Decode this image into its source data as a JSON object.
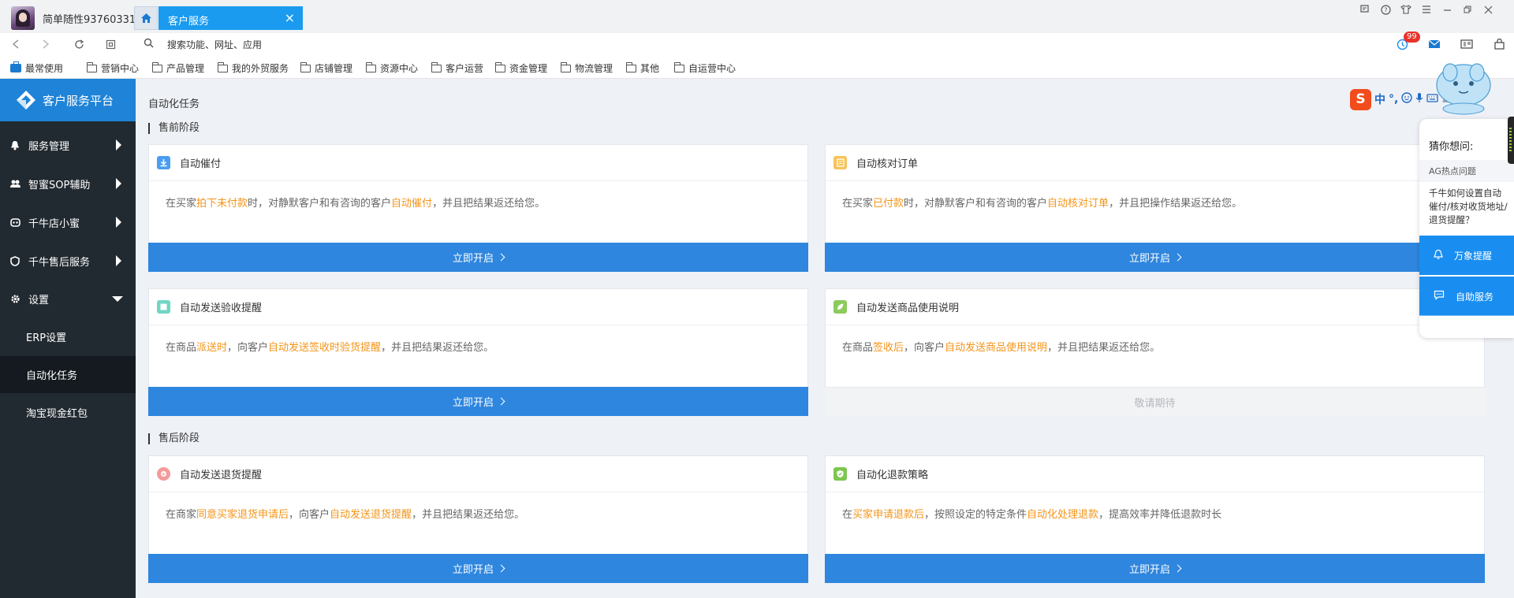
{
  "window": {
    "username": "简单随性93760331",
    "tab_label": "客户服务"
  },
  "address": {
    "search_text": "搜索功能、网址、应用",
    "mail_badge": "99"
  },
  "bookmarks": [
    "最常使用",
    "营销中心",
    "产品管理",
    "我的外贸服务",
    "店铺管理",
    "资源中心",
    "客户运营",
    "资金管理",
    "物流管理",
    "其他",
    "自运营中心"
  ],
  "sidebar": {
    "brand": "客户服务平台",
    "items": [
      {
        "label": "服务管理"
      },
      {
        "label": "智蜜SOP辅助"
      },
      {
        "label": "千牛店小蜜"
      },
      {
        "label": "千牛售后服务"
      },
      {
        "label": "设置"
      }
    ],
    "sub_items": [
      {
        "label": "ERP设置"
      },
      {
        "label": "自动化任务"
      },
      {
        "label": "淘宝现金红包"
      }
    ]
  },
  "main": {
    "page_title": "自动化任务",
    "section_pre": "售前阶段",
    "section_post": "售后阶段",
    "cards": [
      {
        "title": "自动催付",
        "desc": [
          "在买家",
          "拍下未付款",
          "时，对静默客户和有咨询的客户",
          "自动催付",
          "，并且把结果返还给您。"
        ],
        "button": "立即开启"
      },
      {
        "title": "自动核对订单",
        "desc": [
          "在买家",
          "已付款",
          "时，对静默客户和有咨询的客户",
          "自动核对订单",
          "，并且把操作结果返还给您。"
        ],
        "button": "立即开启"
      },
      {
        "title": "自动发送验收提醒",
        "desc": [
          "在商品",
          "派送时",
          "，向客户",
          "自动发送签收时验货提醒",
          "，并且把结果返还给您。"
        ],
        "button": "立即开启"
      },
      {
        "title": "自动发送商品使用说明",
        "desc": [
          "在商品",
          "签收后",
          "，向客户",
          "自动发送商品使用说明",
          "，并且把结果返还给您。"
        ],
        "button": "敬请期待"
      },
      {
        "title": "自动发送退货提醒",
        "desc": [
          "在商家",
          "同意买家退货申请后",
          "，向客户",
          "自动发送退货提醒",
          "，并且把结果返还给您。"
        ],
        "button": "立即开启"
      },
      {
        "title": "自动化退款策略",
        "desc": [
          "在",
          "买家申请退款后",
          "，按照设定的特定条件",
          "自动化处理退款",
          "，提高效率并降低退款时长"
        ],
        "button": "立即开启"
      }
    ]
  },
  "ime": {
    "logo": "S",
    "lang": "中",
    "punct": "°,"
  },
  "assistant": {
    "title": "猜你想问:",
    "hot_label": "AG热点问题",
    "question": "千牛如何设置自动催付/核对收货地址/退货提醒？",
    "btn_reminder": "万象提醒",
    "btn_self_service": "自助服务"
  },
  "colors": {
    "accent": "#2e86de",
    "highlight": "#f39419",
    "sidebar_bg": "#222a31",
    "tab_blue": "#1a9bef"
  }
}
